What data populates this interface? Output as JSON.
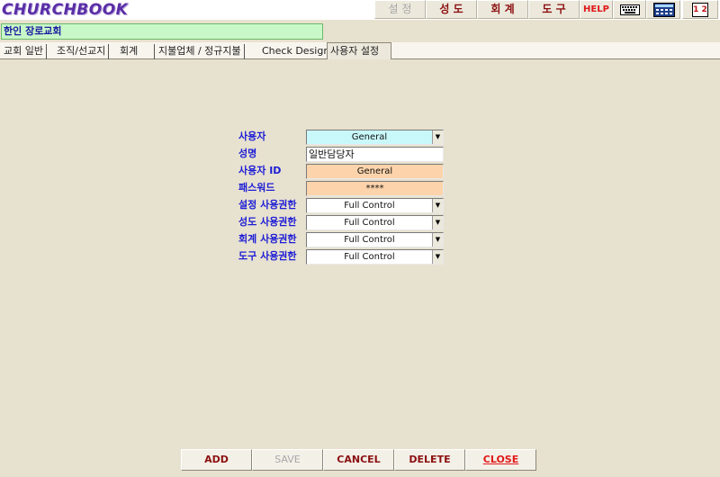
{
  "app": {
    "logo": "CHURCHBOOK"
  },
  "menu": {
    "items": [
      {
        "label": "설 정",
        "disabled": true
      },
      {
        "label": "성 도",
        "disabled": false
      },
      {
        "label": "회 계",
        "disabled": false
      },
      {
        "label": "도 구",
        "disabled": false
      },
      {
        "label": "HELP",
        "disabled": false
      }
    ],
    "icons": [
      "keyboard-icon",
      "calculator-icon",
      "calendar-icon"
    ],
    "calendar_text": "1 2"
  },
  "church": {
    "name": "한인 장로교회"
  },
  "tabs": [
    {
      "label": "교회 일반"
    },
    {
      "label": "조직/선교지"
    },
    {
      "label": "회계"
    },
    {
      "label": "지불업체 / 정규지불"
    },
    {
      "label": "Check Design"
    },
    {
      "label": "사용자 설정",
      "active": true
    }
  ],
  "form": {
    "user": {
      "label": "사용자",
      "value": "General"
    },
    "name": {
      "label": "성명",
      "value": "일반담당자"
    },
    "user_id": {
      "label": "사용자 ID",
      "value": "General"
    },
    "password": {
      "label": "패스워드",
      "value": "****"
    },
    "perm_settings": {
      "label": "설정 사용권한",
      "value": "Full Control"
    },
    "perm_members": {
      "label": "성도 사용권한",
      "value": "Full Control"
    },
    "perm_accounting": {
      "label": "회계 사용권한",
      "value": "Full Control"
    },
    "perm_tools": {
      "label": "도구 사용권한",
      "value": "Full Control"
    }
  },
  "buttons": {
    "add": "ADD",
    "save": "SAVE",
    "cancel": "CANCEL",
    "delete": "DELETE",
    "close": "CLOSE"
  },
  "colors": {
    "background": "#e7e1cf",
    "label_blue": "#1c1cd6",
    "button_text": "#8b1010",
    "close_text": "#e01818",
    "church_field": "#c8f8c8",
    "user_field": "#c9f8fb",
    "id_field": "#fcd3aa"
  }
}
